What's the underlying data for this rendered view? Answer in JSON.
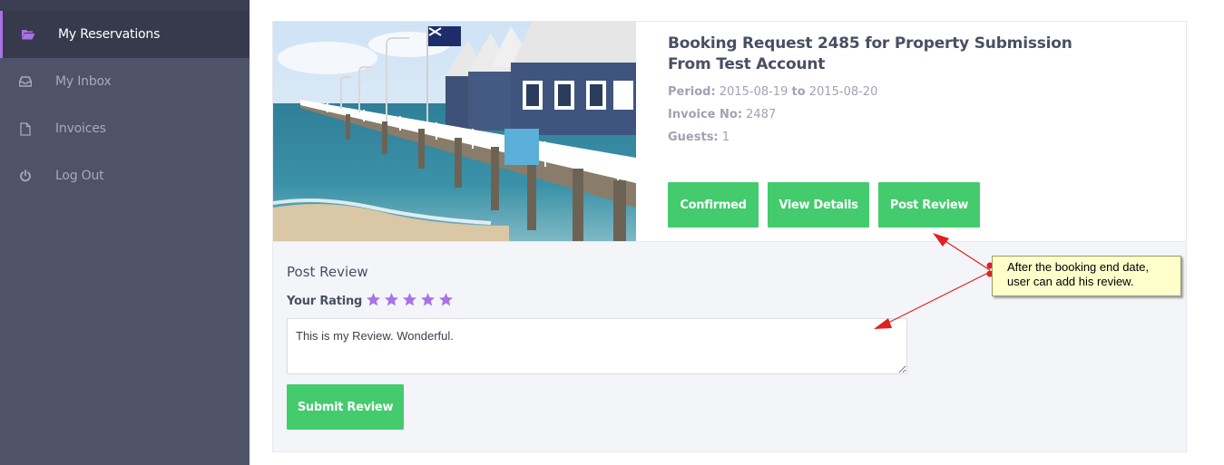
{
  "sidebar": {
    "items": [
      {
        "label": "My Reservations",
        "icon": "folder-open-icon",
        "active": true
      },
      {
        "label": "My Inbox",
        "icon": "inbox-icon",
        "active": false
      },
      {
        "label": "Invoices",
        "icon": "document-icon",
        "active": false
      },
      {
        "label": "Log Out",
        "icon": "power-icon",
        "active": false
      }
    ]
  },
  "booking": {
    "title": "Booking Request 2485 for Property Submission From Test Account",
    "period_label": "Period:",
    "period_start": "2015-08-19",
    "period_to": "to",
    "period_end": "2015-08-20",
    "invoice_label": "Invoice No:",
    "invoice_value": "2487",
    "guests_label": "Guests:",
    "guests_value": "1",
    "buttons": {
      "confirmed": "Confirmed",
      "view_details": "View Details",
      "post_review": "Post Review"
    }
  },
  "review": {
    "heading": "Post Review",
    "rating_label": "Your Rating",
    "stars_total": 5,
    "text": "This is my Review. Wonderful. ",
    "submit_label": "Submit Review"
  },
  "annotation": {
    "line1": "After the booking end date,",
    "line2": "user can add his review."
  },
  "colors": {
    "sidebar_bg": "#4f5369",
    "active_accent": "#a972e6",
    "button_green": "#43cb6d",
    "star_purple": "#a972e6",
    "callout_bg": "#ffffcc",
    "arrow_red": "#e02020"
  }
}
